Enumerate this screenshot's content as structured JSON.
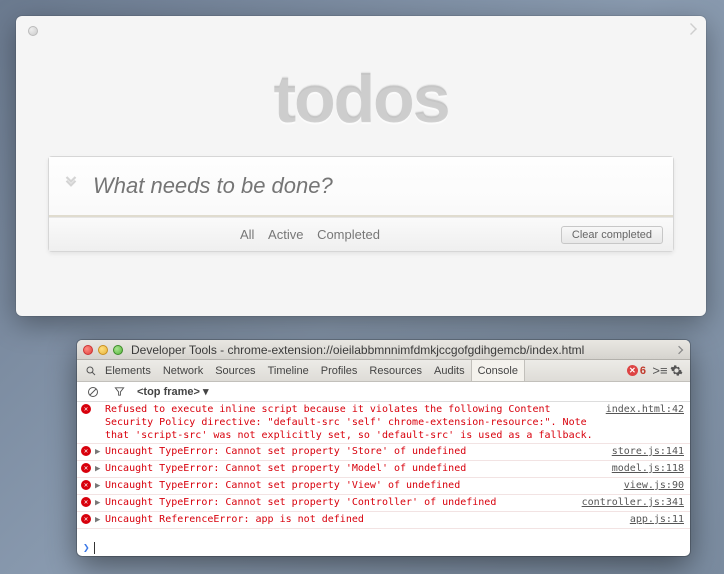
{
  "app": {
    "title": "todos",
    "input_placeholder": "What needs to be done?",
    "filters": {
      "all": "All",
      "active": "Active",
      "completed": "Completed"
    },
    "clear_label": "Clear completed"
  },
  "devtools": {
    "window_title": "Developer Tools - chrome-extension://oieilabbmnnimfdmkjccgofgdihgemcb/index.html",
    "tabs": [
      "Elements",
      "Network",
      "Sources",
      "Timeline",
      "Profiles",
      "Resources",
      "Audits",
      "Console"
    ],
    "active_tab": "Console",
    "error_count": "6",
    "frame_label": "<top frame> ▾",
    "drawer_icon": ">≡",
    "errors": [
      {
        "expandable": false,
        "message": "Refused to execute inline script because it violates the following Content Security Policy directive: \"default-src 'self' chrome-extension-resource:\". Note that 'script-src' was not explicitly set, so 'default-src' is used as a fallback.",
        "source": "index.html:42"
      },
      {
        "expandable": true,
        "message": "Uncaught TypeError: Cannot set property 'Store' of undefined",
        "source": "store.js:141"
      },
      {
        "expandable": true,
        "message": "Uncaught TypeError: Cannot set property 'Model' of undefined",
        "source": "model.js:118"
      },
      {
        "expandable": true,
        "message": "Uncaught TypeError: Cannot set property 'View' of undefined",
        "source": "view.js:90"
      },
      {
        "expandable": true,
        "message": "Uncaught TypeError: Cannot set property 'Controller' of undefined",
        "source": "controller.js:341"
      },
      {
        "expandable": true,
        "message": "Uncaught ReferenceError: app is not defined",
        "source": "app.js:11"
      }
    ],
    "prompt": "❯"
  }
}
